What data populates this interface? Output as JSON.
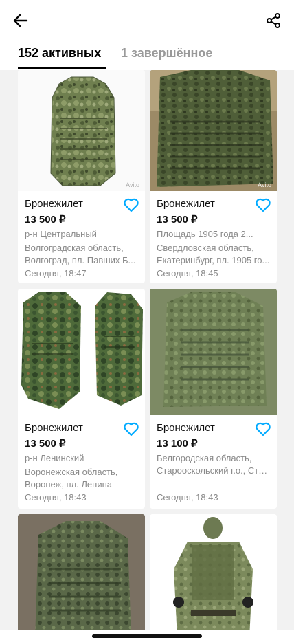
{
  "header": {
    "back_icon": "arrow-left-icon",
    "share_icon": "share-icon"
  },
  "tabs": [
    {
      "label": "152 активных",
      "active": true
    },
    {
      "label": "1 завершённое",
      "active": false
    }
  ],
  "watermark": "Avito",
  "listings": [
    {
      "title": "Бронежилет",
      "price": "13 500 ₽",
      "district": "р-н Центральный",
      "address1": "Волгоградская область,",
      "address2": "Волгоград, пл. Павших Б...",
      "date": "Сегодня, 18:47"
    },
    {
      "title": "Бронежилет",
      "price": "13 500 ₽",
      "district": "Площадь 1905 года 2...",
      "address1": "Свердловская область,",
      "address2": "Екатеринбург, пл. 1905 го...",
      "date": "Сегодня, 18:45"
    },
    {
      "title": "Бронежилет",
      "price": "13 500 ₽",
      "district": "р-н Ленинский",
      "address1": "Воронежская область,",
      "address2": "Воронеж, пл. Ленина",
      "date": "Сегодня, 18:43"
    },
    {
      "title": "Бронежилет",
      "price": "13 100 ₽",
      "district": "",
      "address1": "Белгородская область,",
      "address2": "Старооскольский г.о., Ста...",
      "date": "Сегодня, 18:43"
    },
    {
      "title": "",
      "price": "",
      "district": "",
      "address1": "",
      "address2": "",
      "date": ""
    },
    {
      "title": "",
      "price": "",
      "district": "",
      "address1": "",
      "address2": "",
      "date": ""
    }
  ],
  "colors": {
    "accent": "#00aaff",
    "camo_dark": "#4a5a38",
    "camo_light": "#8c9a6a",
    "text_muted": "#8a8a8a"
  }
}
